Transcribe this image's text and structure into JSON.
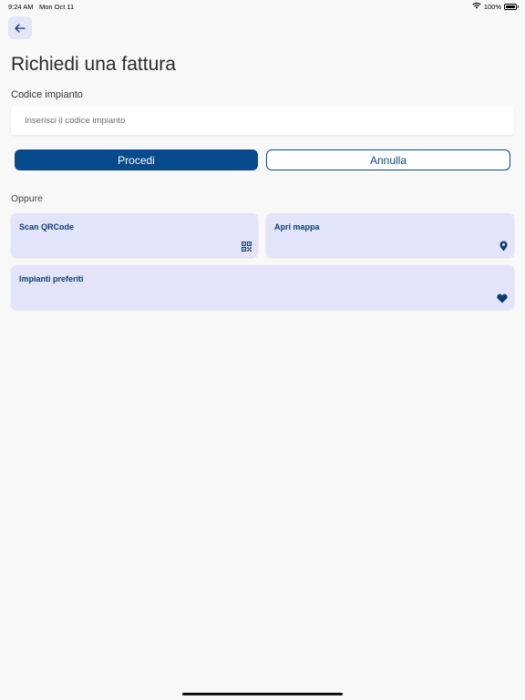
{
  "status_bar": {
    "time": "9:24 AM",
    "date": "Mon Oct 11",
    "battery": "100%",
    "battery_level": 1.0
  },
  "header": {
    "back_icon": "arrow-left-icon",
    "title": "Richiedi una fattura"
  },
  "form": {
    "label": "Codice impianto",
    "placeholder": "Inserisci il codice impianto",
    "value": ""
  },
  "actions": {
    "primary_label": "Procedi",
    "secondary_label": "Annulla"
  },
  "alternatives": {
    "heading": "Oppure",
    "cards": [
      {
        "label": "Scan QRCode",
        "icon": "qrcode-icon"
      },
      {
        "label": "Apri mappa",
        "icon": "map-pin-icon"
      },
      {
        "label": "Impianti preferiti",
        "icon": "heart-icon"
      }
    ]
  },
  "colors": {
    "accent": "#064a8c",
    "card_background": "#e3e4fb",
    "card_text": "#0b3c73",
    "page_background": "#f8f8f8"
  }
}
